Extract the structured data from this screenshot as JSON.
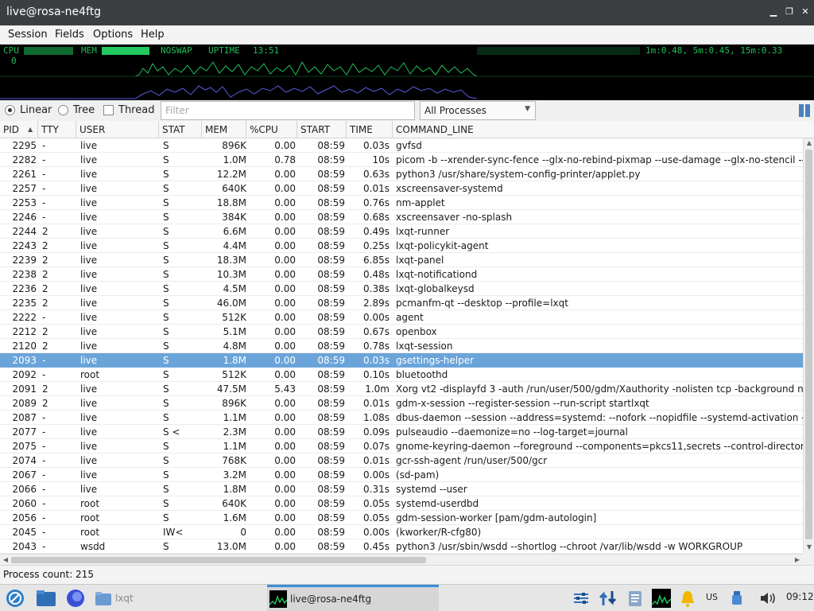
{
  "window": {
    "title": "live@rosa-ne4ftg"
  },
  "menu": [
    "Session",
    "Fields",
    "Options",
    "Help"
  ],
  "graph": {
    "cpu_label": "CPU",
    "cpu_value": "0",
    "mem_label": "MEM",
    "noswap_label": "NOSWAP",
    "uptime_label": "UPTIME",
    "uptime_value": "13:51",
    "load": "1m:0.48, 5m:0.45, 15m:0.33"
  },
  "toolbar": {
    "linear": "Linear",
    "tree": "Tree",
    "thread": "Thread",
    "filter_placeholder": "Filter",
    "filter_value": "",
    "process_filter": "All Processes"
  },
  "columns": [
    "PID",
    "TTY",
    "USER",
    "STAT",
    "MEM",
    "%CPU",
    "START",
    "TIME",
    "COMMAND_LINE"
  ],
  "processes": [
    {
      "pid": "2295",
      "tty": "-",
      "user": "live",
      "stat": "S",
      "mem": "896K",
      "cpu": "0.00",
      "start": "08:59",
      "time": "0.03s",
      "cmd": "gvfsd"
    },
    {
      "pid": "2282",
      "tty": "-",
      "user": "live",
      "stat": "S",
      "mem": "1.0M",
      "cpu": "0.78",
      "start": "08:59",
      "time": "10s",
      "cmd": "picom -b --xrender-sync-fence --glx-no-rebind-pixmap --use-damage --glx-no-stencil --us"
    },
    {
      "pid": "2261",
      "tty": "-",
      "user": "live",
      "stat": "S",
      "mem": "12.2M",
      "cpu": "0.00",
      "start": "08:59",
      "time": "0.63s",
      "cmd": "python3 /usr/share/system-config-printer/applet.py"
    },
    {
      "pid": "2257",
      "tty": "-",
      "user": "live",
      "stat": "S",
      "mem": "640K",
      "cpu": "0.00",
      "start": "08:59",
      "time": "0.01s",
      "cmd": "xscreensaver-systemd"
    },
    {
      "pid": "2253",
      "tty": "-",
      "user": "live",
      "stat": "S",
      "mem": "18.8M",
      "cpu": "0.00",
      "start": "08:59",
      "time": "0.76s",
      "cmd": "nm-applet"
    },
    {
      "pid": "2246",
      "tty": "-",
      "user": "live",
      "stat": "S",
      "mem": "384K",
      "cpu": "0.00",
      "start": "08:59",
      "time": "0.68s",
      "cmd": "xscreensaver -no-splash"
    },
    {
      "pid": "2244",
      "tty": "2",
      "user": "live",
      "stat": "S",
      "mem": "6.6M",
      "cpu": "0.00",
      "start": "08:59",
      "time": "0.49s",
      "cmd": "lxqt-runner"
    },
    {
      "pid": "2243",
      "tty": "2",
      "user": "live",
      "stat": "S",
      "mem": "4.4M",
      "cpu": "0.00",
      "start": "08:59",
      "time": "0.25s",
      "cmd": "lxqt-policykit-agent"
    },
    {
      "pid": "2239",
      "tty": "2",
      "user": "live",
      "stat": "S",
      "mem": "18.3M",
      "cpu": "0.00",
      "start": "08:59",
      "time": "6.85s",
      "cmd": "lxqt-panel"
    },
    {
      "pid": "2238",
      "tty": "2",
      "user": "live",
      "stat": "S",
      "mem": "10.3M",
      "cpu": "0.00",
      "start": "08:59",
      "time": "0.48s",
      "cmd": "lxqt-notificationd"
    },
    {
      "pid": "2236",
      "tty": "2",
      "user": "live",
      "stat": "S",
      "mem": "4.5M",
      "cpu": "0.00",
      "start": "08:59",
      "time": "0.38s",
      "cmd": "lxqt-globalkeysd"
    },
    {
      "pid": "2235",
      "tty": "2",
      "user": "live",
      "stat": "S",
      "mem": "46.0M",
      "cpu": "0.00",
      "start": "08:59",
      "time": "2.89s",
      "cmd": "pcmanfm-qt --desktop --profile=lxqt"
    },
    {
      "pid": "2222",
      "tty": "-",
      "user": "live",
      "stat": "S",
      "mem": "512K",
      "cpu": "0.00",
      "start": "08:59",
      "time": "0.00s",
      "cmd": "agent"
    },
    {
      "pid": "2212",
      "tty": "2",
      "user": "live",
      "stat": "S",
      "mem": "5.1M",
      "cpu": "0.00",
      "start": "08:59",
      "time": "0.67s",
      "cmd": "openbox"
    },
    {
      "pid": "2120",
      "tty": "2",
      "user": "live",
      "stat": "S",
      "mem": "4.8M",
      "cpu": "0.00",
      "start": "08:59",
      "time": "0.78s",
      "cmd": "lxqt-session"
    },
    {
      "pid": "2093",
      "tty": "-",
      "user": "live",
      "stat": "S",
      "mem": "1.8M",
      "cpu": "0.00",
      "start": "08:59",
      "time": "0.03s",
      "cmd": "gsettings-helper"
    },
    {
      "pid": "2092",
      "tty": "-",
      "user": "root",
      "stat": "S",
      "mem": "512K",
      "cpu": "0.00",
      "start": "08:59",
      "time": "0.10s",
      "cmd": "bluetoothd"
    },
    {
      "pid": "2091",
      "tty": "2",
      "user": "live",
      "stat": "S",
      "mem": "47.5M",
      "cpu": "5.43",
      "start": "08:59",
      "time": "1.0m",
      "cmd": "Xorg vt2 -displayfd 3 -auth /run/user/500/gdm/Xauthority -nolisten tcp -background non"
    },
    {
      "pid": "2089",
      "tty": "2",
      "user": "live",
      "stat": "S",
      "mem": "896K",
      "cpu": "0.00",
      "start": "08:59",
      "time": "0.01s",
      "cmd": "gdm-x-session --register-session --run-script startlxqt"
    },
    {
      "pid": "2087",
      "tty": "-",
      "user": "live",
      "stat": "S",
      "mem": "1.1M",
      "cpu": "0.00",
      "start": "08:59",
      "time": "1.08s",
      "cmd": "dbus-daemon --session --address=systemd: --nofork --nopidfile --systemd-activation --sy"
    },
    {
      "pid": "2077",
      "tty": "-",
      "user": "live",
      "stat": "S <",
      "mem": "2.3M",
      "cpu": "0.00",
      "start": "08:59",
      "time": "0.09s",
      "cmd": "pulseaudio --daemonize=no --log-target=journal"
    },
    {
      "pid": "2075",
      "tty": "-",
      "user": "live",
      "stat": "S",
      "mem": "1.1M",
      "cpu": "0.00",
      "start": "08:59",
      "time": "0.07s",
      "cmd": "gnome-keyring-daemon --foreground --components=pkcs11,secrets --control-directory=/"
    },
    {
      "pid": "2074",
      "tty": "-",
      "user": "live",
      "stat": "S",
      "mem": "768K",
      "cpu": "0.00",
      "start": "08:59",
      "time": "0.01s",
      "cmd": "gcr-ssh-agent /run/user/500/gcr"
    },
    {
      "pid": "2067",
      "tty": "-",
      "user": "live",
      "stat": "S",
      "mem": "3.2M",
      "cpu": "0.00",
      "start": "08:59",
      "time": "0.00s",
      "cmd": "(sd-pam)"
    },
    {
      "pid": "2066",
      "tty": "-",
      "user": "live",
      "stat": "S",
      "mem": "1.8M",
      "cpu": "0.00",
      "start": "08:59",
      "time": "0.31s",
      "cmd": "systemd --user"
    },
    {
      "pid": "2060",
      "tty": "-",
      "user": "root",
      "stat": "S",
      "mem": "640K",
      "cpu": "0.00",
      "start": "08:59",
      "time": "0.05s",
      "cmd": "systemd-userdbd"
    },
    {
      "pid": "2056",
      "tty": "-",
      "user": "root",
      "stat": "S",
      "mem": "1.6M",
      "cpu": "0.00",
      "start": "08:59",
      "time": "0.05s",
      "cmd": "gdm-session-worker [pam/gdm-autologin]"
    },
    {
      "pid": "2045",
      "tty": "-",
      "user": "root",
      "stat": "IW<",
      "mem": "0",
      "cpu": "0.00",
      "start": "08:59",
      "time": "0.00s",
      "cmd": "(kworker/R-cfg80)"
    },
    {
      "pid": "2043",
      "tty": "-",
      "user": "wsdd",
      "stat": "S",
      "mem": "13.0M",
      "cpu": "0.00",
      "start": "08:59",
      "time": "0.45s",
      "cmd": "python3 /usr/sbin/wsdd --shortlog --chroot /var/lib/wsdd -w WORKGROUP"
    }
  ],
  "selected_pid": "2093",
  "status": {
    "process_count": "Process count: 215"
  },
  "taskbar": {
    "folder_label": "lxqt",
    "active_task": "live@rosa-ne4ftg",
    "keyboard": "US",
    "clock": "09:12"
  },
  "colors": {
    "selection": "#6aa4d9",
    "graph_cpu": "#1fbf5a",
    "graph_mem": "#5a5ae0",
    "titlebar": "#3c3f42"
  }
}
